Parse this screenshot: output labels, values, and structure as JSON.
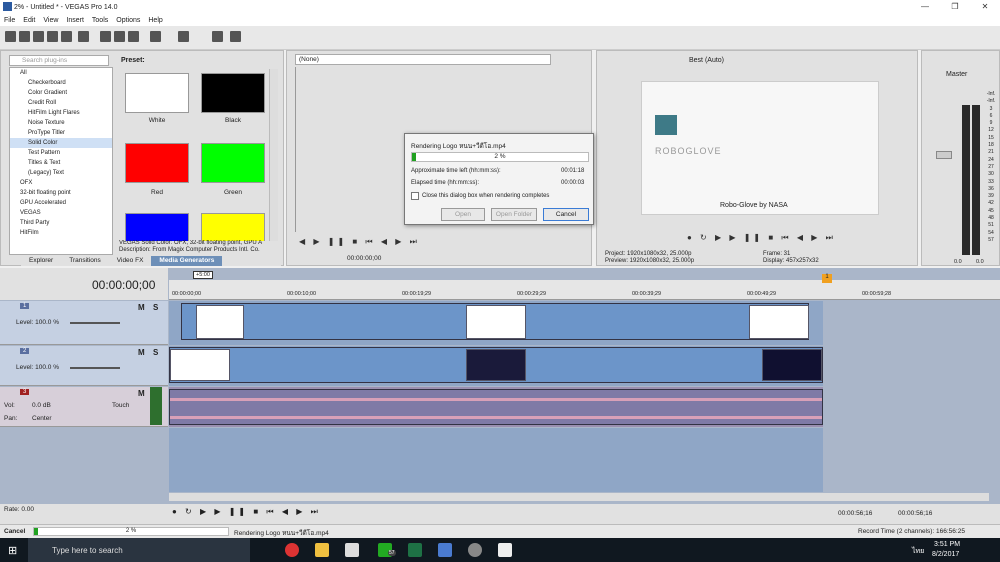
{
  "window": {
    "title": "2% - Untitled * - VEGAS Pro 14.0"
  },
  "menu": [
    "File",
    "Edit",
    "View",
    "Insert",
    "Tools",
    "Options",
    "Help"
  ],
  "search": {
    "placeholder": "Search plug-ins"
  },
  "tree": {
    "items": [
      {
        "label": "All",
        "level": 0
      },
      {
        "label": "Checkerboard",
        "level": 1
      },
      {
        "label": "Color Gradient",
        "level": 1
      },
      {
        "label": "Credit Roll",
        "level": 1
      },
      {
        "label": "HitFilm Light Flares",
        "level": 1
      },
      {
        "label": "Noise Texture",
        "level": 1
      },
      {
        "label": "ProType Titler",
        "level": 1
      },
      {
        "label": "Solid Color",
        "level": 1,
        "selected": true
      },
      {
        "label": "Test Pattern",
        "level": 1
      },
      {
        "label": "Titles & Text",
        "level": 1
      },
      {
        "label": "(Legacy) Text",
        "level": 1
      },
      {
        "label": "OFX",
        "level": 0
      },
      {
        "label": "32-bit floating point",
        "level": 0
      },
      {
        "label": "GPU Accelerated",
        "level": 0
      },
      {
        "label": "VEGAS",
        "level": 0
      },
      {
        "label": "Third Party",
        "level": 0
      },
      {
        "label": "HitFilm",
        "level": 0
      }
    ]
  },
  "presets": {
    "title": "Preset:",
    "items": [
      {
        "label": "White",
        "color": "#ffffff"
      },
      {
        "label": "Black",
        "color": "#000000"
      },
      {
        "label": "Red",
        "color": "#ff0000"
      },
      {
        "label": "Green",
        "color": "#00ff00"
      },
      {
        "label": "",
        "color": "#0000ff"
      },
      {
        "label": "",
        "color": "#ffff00"
      }
    ],
    "description1": "VEGAS Solid Color: OFX, 32-bit floating point, GPU A",
    "description2": "Description: From Magix Computer Products Intl. Co."
  },
  "tabs": [
    "Explorer",
    "Transitions",
    "Video FX",
    "Media Generators"
  ],
  "trimmer": {
    "select": "(None)",
    "timecode": "00:00:00;00"
  },
  "preview": {
    "quality": "Best (Auto)",
    "logo_text": "ROBOGLOVE",
    "caption": "Robo-Glove by NASA",
    "project": "Project:  1920x1080x32, 25.000p",
    "previewres": "Preview:  1920x1080x32, 25.000p",
    "frame": "Frame:   31",
    "display": "Display:   457x257x32"
  },
  "master": {
    "label": "Master",
    "scale": [
      "-Inf.",
      "-Inf.",
      "3",
      "6",
      "9",
      "12",
      "15",
      "18",
      "21",
      "24",
      "27",
      "30",
      "33",
      "36",
      "39",
      "42",
      "45",
      "48",
      "51",
      "54",
      "57"
    ],
    "db1": "0.0",
    "db2": "0.0"
  },
  "render": {
    "title": "Rendering Logo หนน+วีดีโอ.mp4",
    "percent": "2 %",
    "progress": 0.02,
    "left_label": "Approximate time left (hh:mm:ss):",
    "left_val": "00:01:18",
    "elapsed_label": "Elapsed time (hh:mm:ss):",
    "elapsed_val": "00:00:03",
    "checkbox": "Close this dialog box when rendering completes",
    "open": "Open",
    "open_folder": "Open Folder",
    "cancel": "Cancel"
  },
  "timeline": {
    "timecode": "00:00:00;00",
    "ruler": [
      "00:00:00;00",
      "00:00:10;00",
      "00:00:19;29",
      "00:00:29;29",
      "00:00:39;29",
      "00:00:49;29",
      "00:00:59;28"
    ],
    "marker": "1",
    "region": "+5:00"
  },
  "tracks": [
    {
      "num": "1",
      "level": "Level: 100.0 %"
    },
    {
      "num": "2",
      "level": "Level: 100.0 %"
    },
    {
      "num": "3",
      "vol": "Vol:",
      "vol_val": "0.0 dB",
      "touch": "Touch",
      "pan": "Pan:",
      "pan_val": "Center"
    }
  ],
  "transport": {
    "rate": "Rate: 0.00",
    "end_time": "00:00:56;16",
    "duration": "00:00:56;16"
  },
  "status": {
    "cancel": "Cancel",
    "percent": "2 %",
    "render": "Rendering Logo หนน+วีดีโอ.mp4",
    "record": "Record Time (2 channels):  166:56:25"
  },
  "taskbar": {
    "search": "Type here to search",
    "time": "3:51 PM",
    "date": "8/2/2017",
    "lang": "ไทย",
    "badge": "57"
  }
}
